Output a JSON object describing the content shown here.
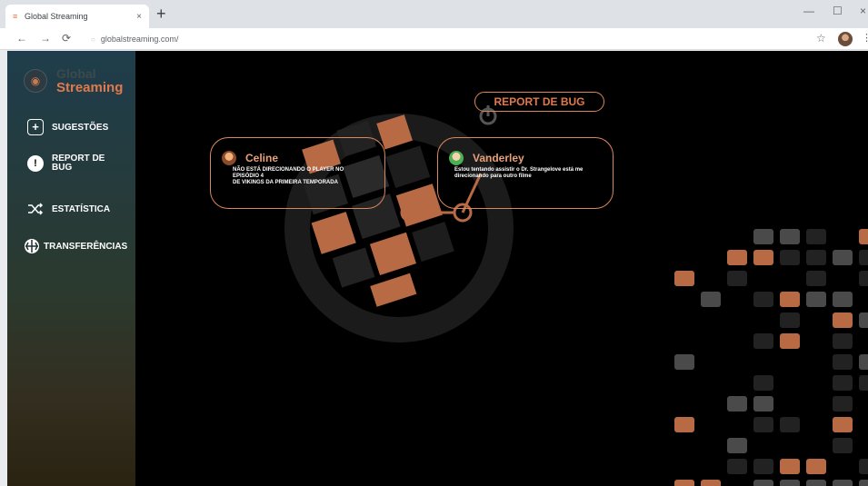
{
  "browser": {
    "tab_title": "Global Streaming",
    "tab_close": "×",
    "new_tab": "+",
    "url": "globalstreaming.com/",
    "win_minimize": "—",
    "win_maximize": "☐",
    "win_close": "×",
    "back": "←",
    "forward": "→",
    "reload": "⟳",
    "star": "☆",
    "menu": "⋮"
  },
  "sidebar": {
    "brand_line1": "Global",
    "brand_line2": "Streaming",
    "items": [
      {
        "label": "SUGESTÕES",
        "icon": "plus-icon"
      },
      {
        "label": "REPORT DE BUG",
        "label_line1": "REPORT DE",
        "label_line2": "BUG",
        "icon": "alert-icon"
      },
      {
        "label": "ESTATÍSTICA",
        "icon": "shuffle-icon"
      },
      {
        "label": "TRANSFERÊNCIAS",
        "icon": "transfer-icon"
      }
    ]
  },
  "main": {
    "title": "REPORT DE BUG",
    "reports": [
      {
        "user": "Celine",
        "message_line1": "NÃO ESTÁ DIRECIONANDO O PLAYER NO",
        "message_line2": "EPISÓDIO 4",
        "message_line3": "DE VIKINGS DA PRIMEIRA TEMPORADA"
      },
      {
        "user": "Vanderley",
        "message_line1": "Estou tentando assistir o Dr. Strangelove está me",
        "message_line2": "direcionando para outro filme"
      }
    ]
  },
  "colors": {
    "accent": "#e07a4c",
    "card_border": "#d9885d",
    "background": "#000000"
  }
}
